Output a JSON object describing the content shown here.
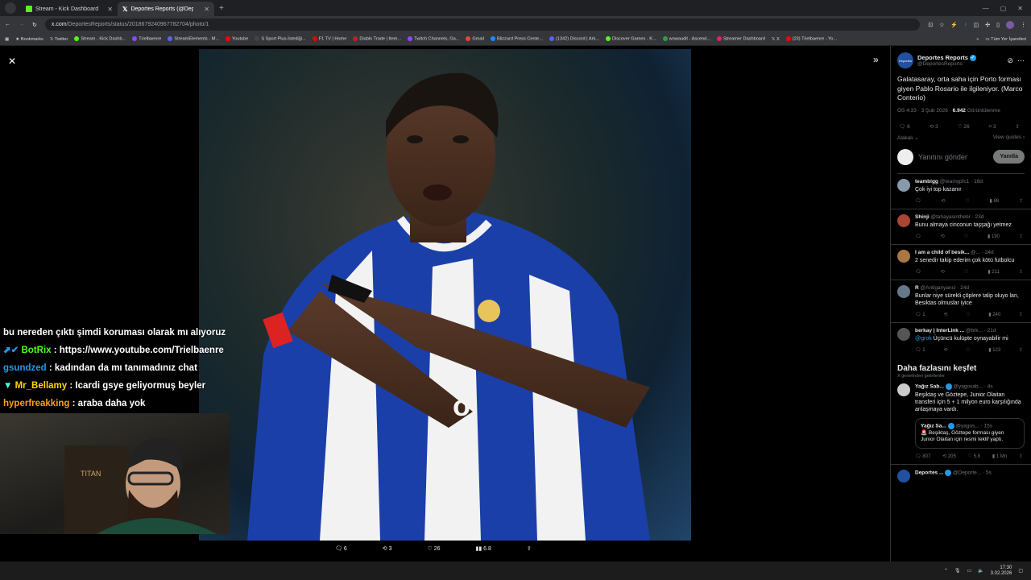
{
  "tabs": [
    {
      "label": "Stream - Kick Dashboard",
      "active": false
    },
    {
      "label": "Deportes Reports (@DeportesR...",
      "active": true
    }
  ],
  "address": {
    "domain": "x.com",
    "path": "/DeportesReports/status/2018679240967782704/photo/1"
  },
  "bookmarks": [
    "Bookmarks",
    "Twitter",
    "Stream - Kick Dashb...",
    "Trielbaenre",
    "StreamElements - M...",
    "Youtube",
    "S Sport Plus-İstediği...",
    "F1 TV | Home",
    "Diablo Trade | Item...",
    "Twitch Channels, Ga...",
    "Gmail",
    "Blizzard Press Cente...",
    "(1342) Discord | Ark...",
    "Discover Games - K...",
    "wowaudit - Ascend...",
    "Streamer Dashboard",
    "X",
    "(23) Trielbaenre - Yo..."
  ],
  "bookmarks_all": "Tüm Yer İşaretleri",
  "photo_actions": {
    "replies": "6",
    "reposts": "3",
    "likes": "26",
    "views": "6.8"
  },
  "chat": [
    {
      "user": "",
      "text": "bu nereden çıktı şimdi koruması olarak mı alıyoruz",
      "color": "#ffffff"
    },
    {
      "user": "BotRix",
      "text": ": https://www.youtube.com/Trielbaenre",
      "color": "#53fc18"
    },
    {
      "user": "gsundzed",
      "text": ": kadından da mı tanımadınız chat",
      "color": "#1d9bf0"
    },
    {
      "user": "Mr_Bellamy",
      "text": ": Icardi gsye geliyormuş beyler",
      "color": "#ffd700"
    },
    {
      "user": "hyperfreakking",
      "text": ": araba daha yok",
      "color": "#ff9f1c"
    }
  ],
  "tweet": {
    "author": "Deportes Reports",
    "handle": "@DeportesReports",
    "text": "Galatasaray, orta saha için Porto forması giyen Pablo Rosario ile ilgileniyor. (Marco Conterio)",
    "time": "ÖS 4:33 · 3 Şub 2026 · ",
    "views": "6.942",
    "views_label": " Görüntülenme",
    "replies": "6",
    "reposts": "3",
    "likes": "26",
    "bookmarks": "3",
    "sort_label": "Alakalı",
    "view_quotes": "View quotes",
    "reply_placeholder": "Yanıtını gönder",
    "reply_button": "Yanıtla"
  },
  "replies": [
    {
      "name": "teambigg",
      "handle": "@teamypfc1 · 16d",
      "text": "Çok iyi top kazanır",
      "views": "88",
      "color": "#8899aa"
    },
    {
      "name": "Shinji",
      "handle": "@tahayasinthebr · 23d",
      "text": "Bunu almaya cinconun taşşağı yetmez",
      "views": "190",
      "color": "#aa4433"
    },
    {
      "name": "I am a child of besik...",
      "handle": "@... · 24d",
      "text": "2 senedir takip ederim çok kötü futbolcu",
      "views": "211",
      "color": "#aa7744"
    },
    {
      "name": "R",
      "handle": "@Antiganyanci · 24d",
      "text": "Bunlar niye sürekli çöplere talip oluyo lan, Besiktas olmuslar iyice",
      "views": "240",
      "color": "#667788",
      "replies": "1"
    },
    {
      "name": "berkay | InterLink ...",
      "handle": "@brk... · 21d",
      "mention": "@grok",
      "text": " Üçüncü kulüpte oynayabilir mi",
      "views": "123",
      "color": "#555555",
      "replies": "1"
    }
  ],
  "explore": {
    "title": "Daha fazlasını keşfet",
    "subtitle": "X genelinden getirilenler"
  },
  "explore_post": {
    "name": "Yağız Sab...",
    "handle": "@yagosab... · 4s",
    "text": "Beşiktaş ve Göztepe, Junior Olaitan transferi için 5 + 1 milyon euro karşılığında anlaşmaya vardı.",
    "quote_name": "Yağız Sa...",
    "quote_handle": "@yagos... · 15s",
    "quote_text": "🚨 Beşiktaş, Göztepe forması giyen Junior Olaitan için resmi teklif yaptı.",
    "replies": "807",
    "reposts": "205",
    "likes": "5.8",
    "views": "1 Mn"
  },
  "next_post": {
    "name": "Deportes ...",
    "handle": "@Deporte... · 5s"
  },
  "clock": {
    "time": "17:30",
    "date": "3.02.2026"
  }
}
